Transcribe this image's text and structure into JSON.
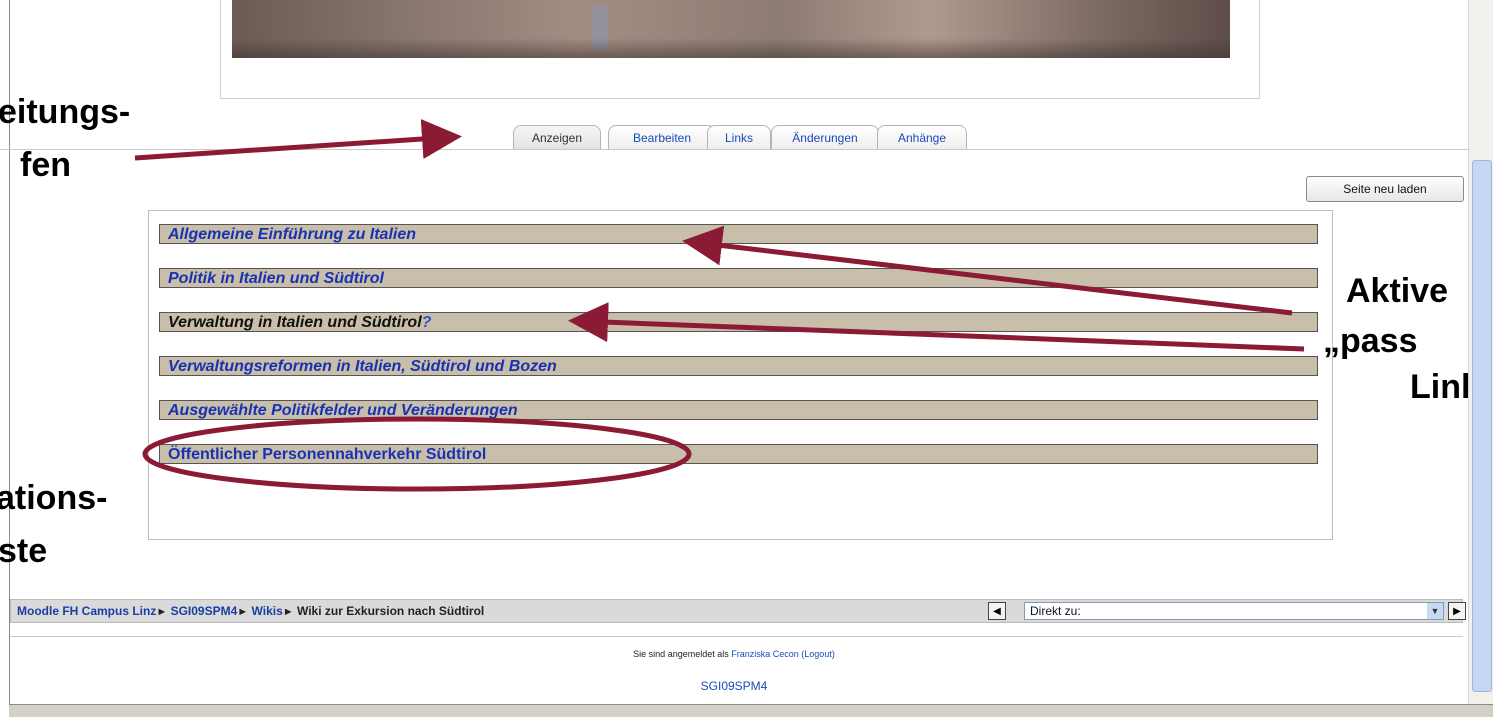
{
  "tabs": [
    {
      "label": "Anzeigen",
      "active": true
    },
    {
      "label": "Bearbeiten",
      "active": false
    },
    {
      "label": "Links",
      "active": false
    },
    {
      "label": "Änderungen",
      "active": false
    },
    {
      "label": "Anhänge",
      "active": false
    }
  ],
  "reload_button": "Seite neu laden",
  "wiki_links": [
    {
      "label": "Allgemeine Einführung zu Italien",
      "state": "active"
    },
    {
      "label": "Politik in Italien und Südtirol",
      "state": "active"
    },
    {
      "label": "Verwaltung in Italien und Südtirol",
      "suffix": "?",
      "state": "passive"
    },
    {
      "label": "Verwaltungsreformen in Italien, Südtirol und Bozen",
      "state": "active"
    },
    {
      "label": "Ausgewählte Politikfelder und Veränderungen",
      "state": "active"
    },
    {
      "label": "Öffentlicher Personennahverkehr Südtirol",
      "state": "active"
    }
  ],
  "breadcrumb": {
    "items": [
      "Moodle FH Campus Linz",
      "SGI09SPM4",
      "Wikis"
    ],
    "current": "Wiki zur Exkursion nach Südtirol",
    "separator": "►"
  },
  "jump_select": {
    "selected": "Direkt zu:"
  },
  "login": {
    "prefix": "Sie sind angemeldet als",
    "user": "Franziska Cecon",
    "logout": "(Logout)"
  },
  "course_link": "SGI09SPM4",
  "annotations": {
    "top_left_1": "eitungs-",
    "top_left_2": "fen",
    "bottom_left_1": "ations-",
    "bottom_left_2": "ste",
    "right_1": "Aktive",
    "right_2": "„pass",
    "right_3": "Linl"
  },
  "colors": {
    "arrow": "#8b1a34",
    "row_bg": "#c9bea9",
    "link": "#1733b3"
  }
}
